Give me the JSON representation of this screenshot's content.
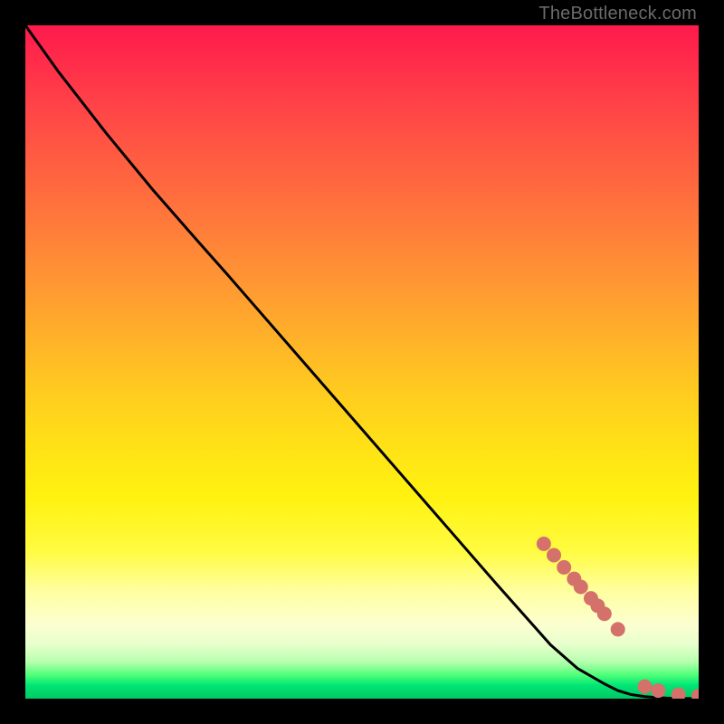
{
  "attribution": "TheBottleneck.com",
  "chart_data": {
    "type": "line",
    "title": "",
    "xlabel": "",
    "ylabel": "",
    "xlim": [
      0,
      100
    ],
    "ylim": [
      0,
      100
    ],
    "grid": false,
    "series": [
      {
        "name": "curve",
        "color": "#000000",
        "style": "line",
        "x": [
          0,
          5,
          12,
          19,
          26,
          30,
          40,
          50,
          60,
          70,
          78,
          82,
          86,
          88,
          90,
          92,
          94,
          96,
          98,
          100
        ],
        "y": [
          100,
          93,
          84,
          75.5,
          67.5,
          63,
          51.5,
          40,
          28.5,
          17,
          8,
          4.5,
          2.2,
          1.2,
          0.6,
          0.3,
          0.15,
          0.05,
          0.02,
          0
        ]
      },
      {
        "name": "markers",
        "color": "#d4716b",
        "style": "points",
        "x": [
          77,
          78.5,
          80,
          81.5,
          82.5,
          84,
          85,
          86,
          88,
          92,
          94,
          97,
          100
        ],
        "y": [
          23,
          21.3,
          19.5,
          17.8,
          16.6,
          14.9,
          13.8,
          12.6,
          10.3,
          1.8,
          1.2,
          0.6,
          0.4
        ]
      }
    ]
  }
}
